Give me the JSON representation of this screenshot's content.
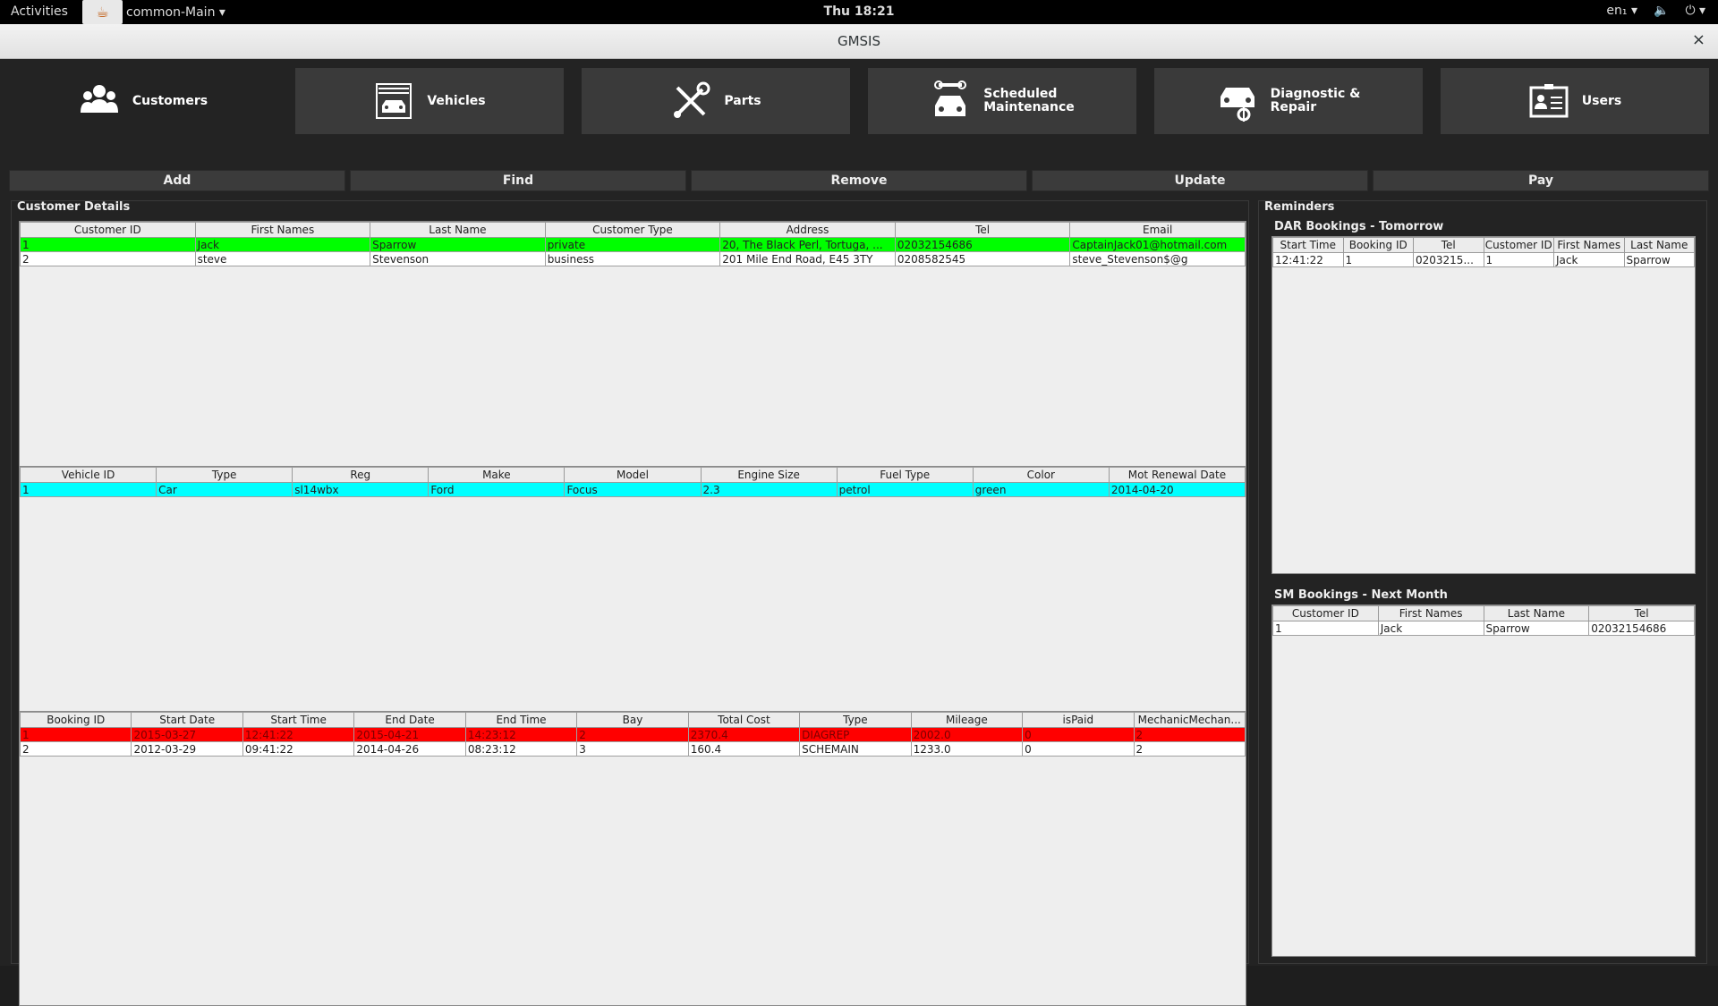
{
  "system_bar": {
    "activities": "Activities",
    "app_menu": "common-Main ▾",
    "clock": "Thu 18:21",
    "lang": "en₁ ▾",
    "volume_icon": "🔈",
    "power_icon": "⏻ ▾"
  },
  "window": {
    "title": "GMSIS",
    "close": "×"
  },
  "nav": {
    "customers": "Customers",
    "vehicles": "Vehicles",
    "parts": "Parts",
    "scheduled_maintenance_1": "Scheduled",
    "scheduled_maintenance_2": "Maintenance",
    "diagnostic_1": "Diagnostic &",
    "diagnostic_2": "Repair",
    "users": "Users"
  },
  "actions": {
    "add": "Add",
    "find": "Find",
    "remove": "Remove",
    "update": "Update",
    "pay": "Pay"
  },
  "customer_details": {
    "title": "Customer Details",
    "customers": {
      "headers": [
        "Customer ID",
        "First Names",
        "Last Name",
        "Customer Type",
        "Address",
        "Tel",
        "Email"
      ],
      "rows": [
        [
          "1",
          "Jack",
          "Sparrow",
          "private",
          "20, The Black Perl, Tortuga, ...",
          "02032154686",
          "CaptainJack01@hotmail.com"
        ],
        [
          "2",
          "steve",
          "Stevenson",
          "business",
          "201 Mile End Road, E45 3TY",
          "0208582545",
          "steve_Stevenson$@g"
        ]
      ]
    },
    "vehicles": {
      "headers": [
        "Vehicle ID",
        "Type",
        "Reg",
        "Make",
        "Model",
        "Engine Size",
        "Fuel Type",
        "Color",
        "Mot Renewal Date"
      ],
      "rows": [
        [
          "1",
          "Car",
          "sl14wbx",
          "Ford",
          "Focus",
          "2.3",
          "petrol",
          "green",
          "2014-04-20"
        ]
      ]
    },
    "bookings": {
      "headers": [
        "Booking ID",
        "Start Date",
        "Start Time",
        "End Date",
        "End Time",
        "Bay",
        "Total Cost",
        "Type",
        "Mileage",
        "isPaid",
        "MechanicMechan..."
      ],
      "rows": [
        [
          "1",
          "2015-03-27",
          "12:41:22",
          "2015-04-21",
          "14:23:12",
          "2",
          "2370.4",
          "DIAGREP",
          "2002.0",
          "0",
          "2"
        ],
        [
          "2",
          "2012-03-29",
          "09:41:22",
          "2014-04-26",
          "08:23:12",
          "3",
          "160.4",
          "SCHEMAIN",
          "1233.0",
          "0",
          "2"
        ]
      ]
    }
  },
  "reminders": {
    "title": "Reminders",
    "dar": {
      "title": "DAR Bookings - Tomorrow",
      "headers": [
        "Start Time",
        "Booking ID",
        "Tel",
        "Customer ID",
        "First Names",
        "Last Name"
      ],
      "rows": [
        [
          "12:41:22",
          "1",
          "0203215...",
          "1",
          "Jack",
          "Sparrow"
        ]
      ]
    },
    "sm": {
      "title": "SM Bookings - Next Month",
      "headers": [
        "Customer ID",
        "First Names",
        "Last Name",
        "Tel"
      ],
      "rows": [
        [
          "1",
          "Jack",
          "Sparrow",
          "02032154686"
        ]
      ]
    }
  }
}
